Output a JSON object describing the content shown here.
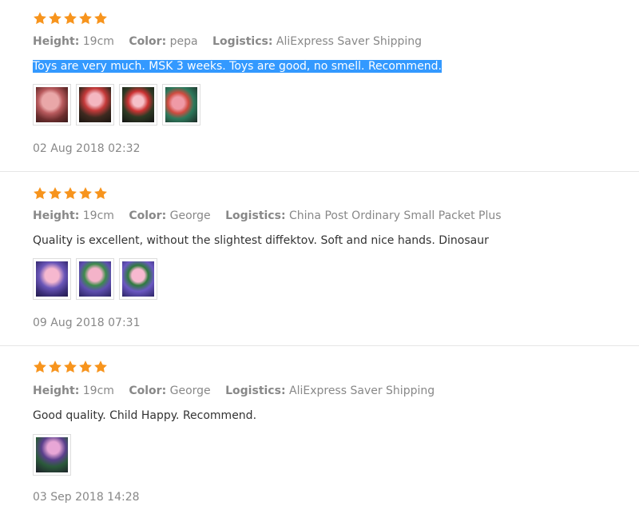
{
  "colors": {
    "star": "#f7941d",
    "selection": "#3399ff",
    "divider": "#e6e6e6"
  },
  "labels": {
    "height": "Height:",
    "color": "Color:",
    "logistics": "Logistics:"
  },
  "reviews": [
    {
      "rating": 5,
      "height": "19cm",
      "color": "pepa",
      "logistics": "AliExpress Saver Shipping",
      "text": "Toys are very much. MSK 3 weeks. Toys are good, no smell. Recommend.",
      "text_selected": true,
      "photo_count": 4,
      "date": "02 Aug 2018 02:32"
    },
    {
      "rating": 5,
      "height": "19cm",
      "color": "George",
      "logistics": "China Post Ordinary Small Packet Plus",
      "text": "Quality is excellent, without the slightest diffektov. Soft and nice hands. Dinosaur",
      "text_selected": false,
      "photo_count": 3,
      "date": "09 Aug 2018 07:31"
    },
    {
      "rating": 5,
      "height": "19cm",
      "color": "George",
      "logistics": "AliExpress Saver Shipping",
      "text": "Good quality. Child Happy. Recommend.",
      "text_selected": false,
      "photo_count": 1,
      "date": "03 Sep 2018 14:28"
    }
  ]
}
